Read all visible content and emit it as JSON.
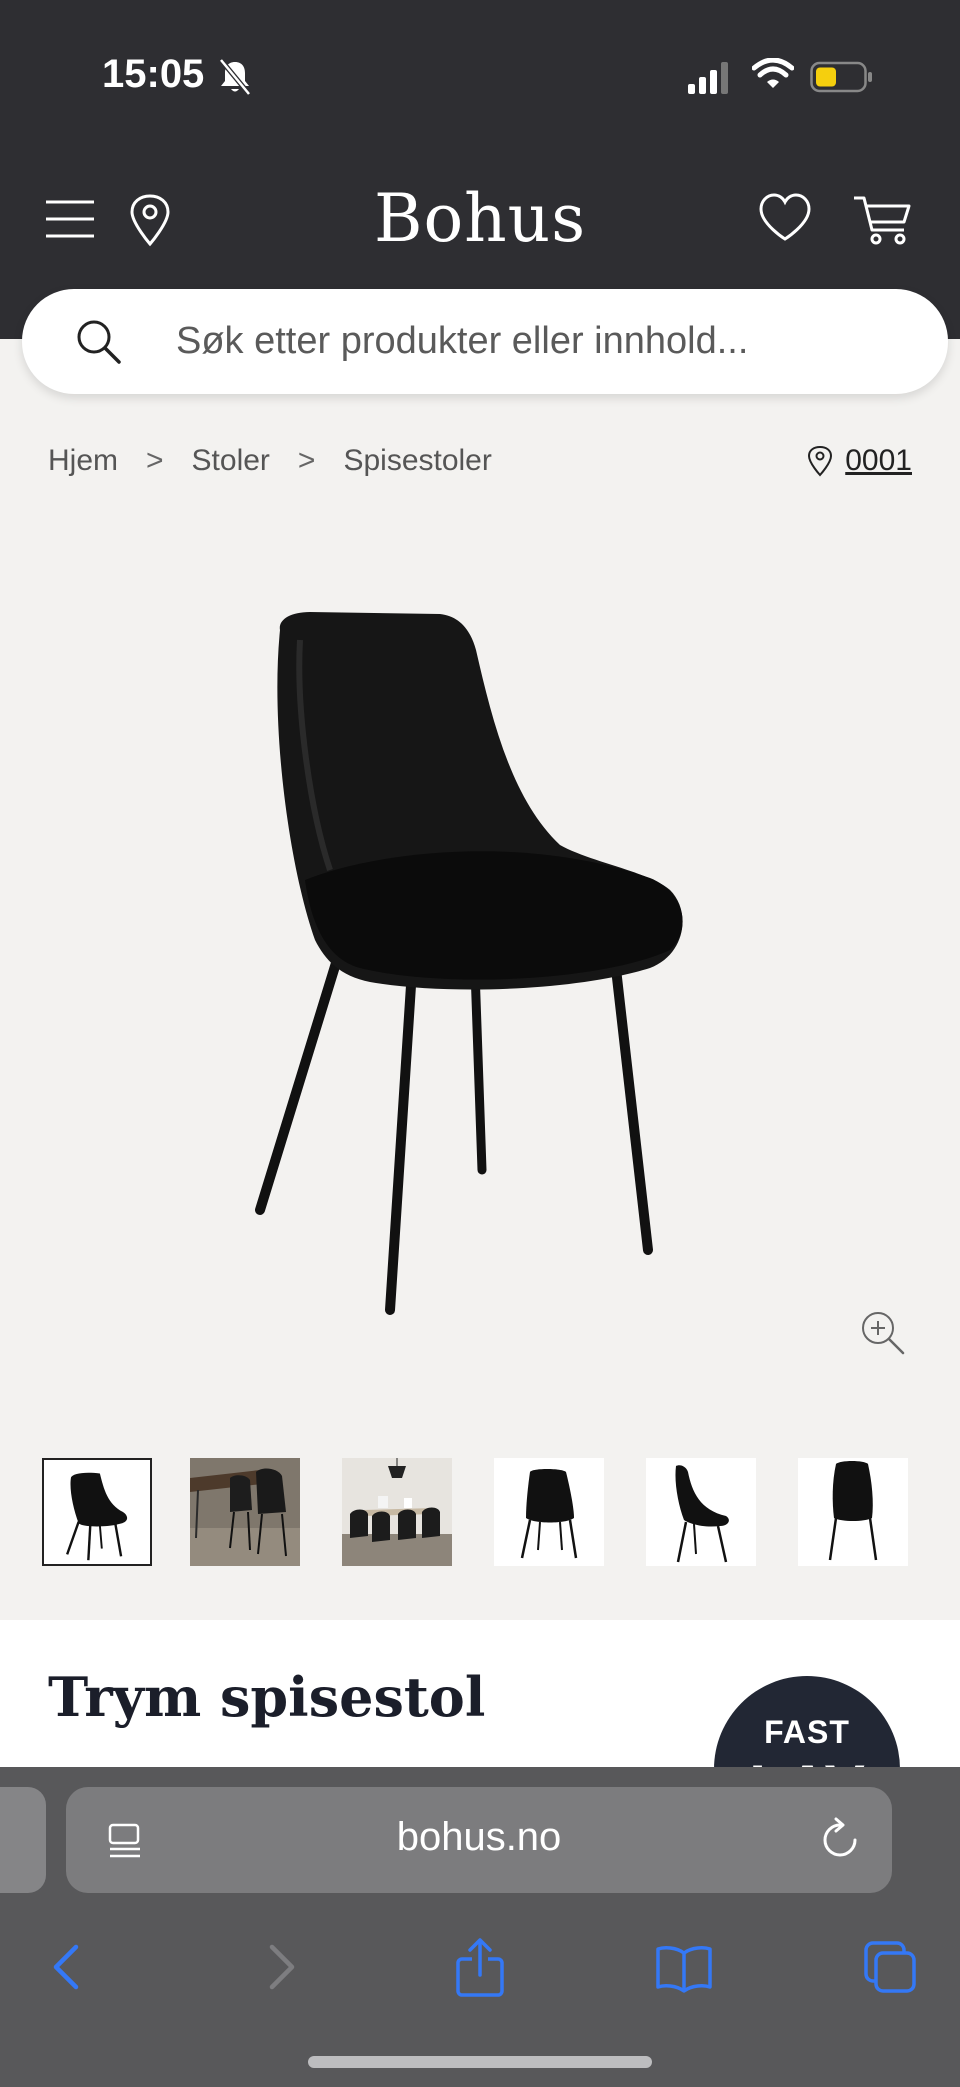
{
  "status_bar": {
    "time": "15:05"
  },
  "header": {
    "brand": "Bohus"
  },
  "search": {
    "placeholder": "Søk etter produkter eller innhold..."
  },
  "breadcrumb": {
    "items": [
      "Hjem",
      "Stoler",
      "Spisestoler"
    ],
    "separator": ">"
  },
  "store": {
    "label": "0001"
  },
  "product": {
    "title": "Trym spisestol",
    "badge_line1": "FAST",
    "badge_line2": "LAV"
  },
  "thumbnails": {
    "count": 6,
    "active_index": 0
  },
  "browser": {
    "url": "bohus.no"
  },
  "colors": {
    "header_bg": "#2e2e32",
    "page_bg": "#f3f2f0",
    "title_color": "#1b1e2a",
    "badge_bg": "#222734",
    "ios_blue": "#3478f6"
  },
  "icons": [
    "bell-off-icon",
    "signal-icon",
    "wifi-icon",
    "battery-icon",
    "menu-icon",
    "location-pin-icon",
    "heart-icon",
    "cart-icon",
    "search-icon",
    "chevron-right-icon",
    "zoom-in-icon",
    "reader-icon",
    "reload-icon",
    "back-icon",
    "forward-icon",
    "share-icon",
    "bookmarks-icon",
    "tabs-icon"
  ]
}
